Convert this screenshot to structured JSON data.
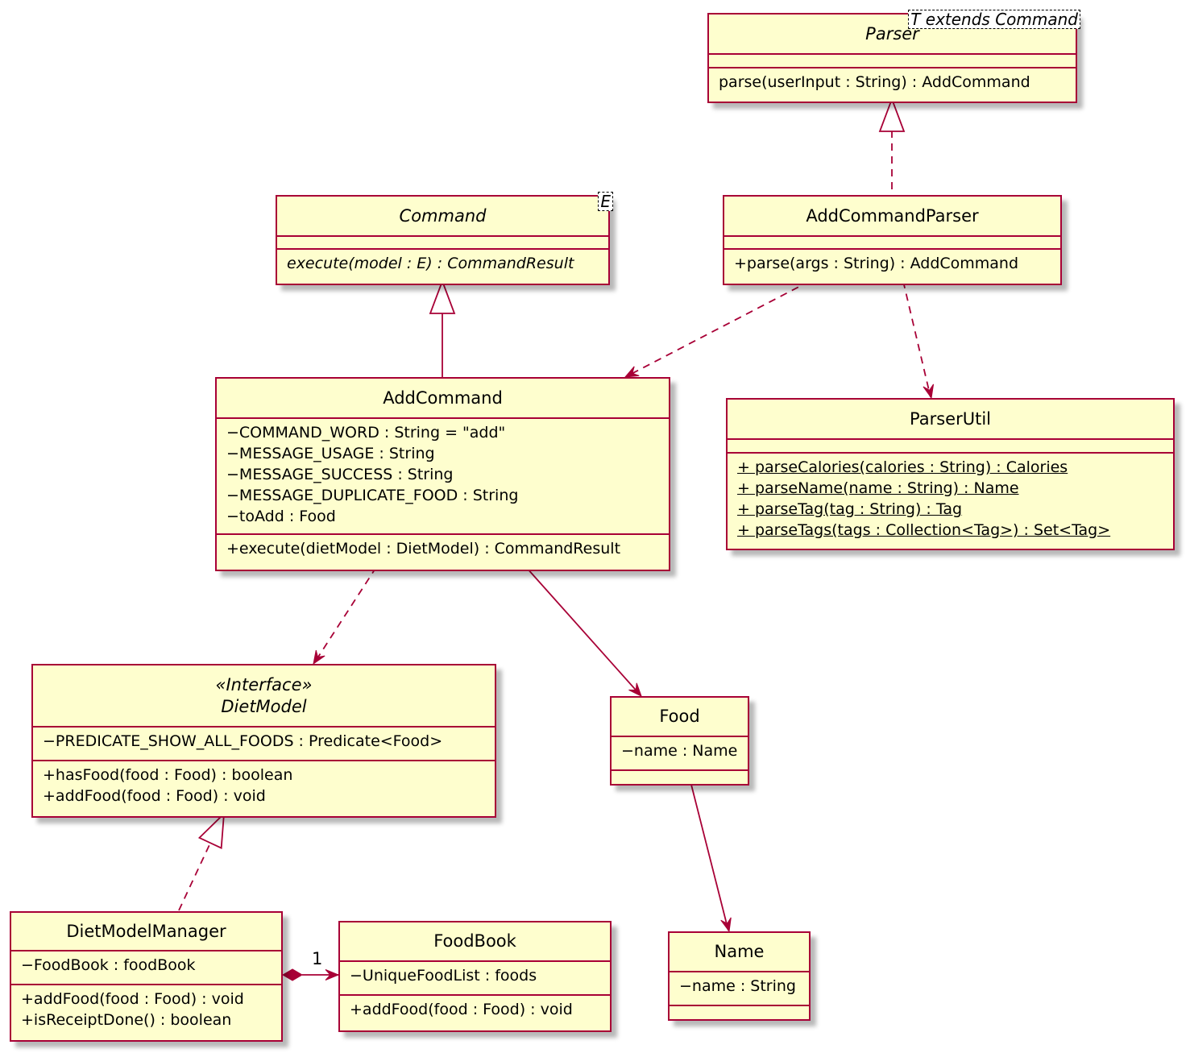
{
  "colors": {
    "border": "#A80036",
    "fill": "#FEFECE"
  },
  "classes": [
    {
      "id": "parser",
      "name": "Parser",
      "italic": true,
      "template": "T extends Command",
      "attributes": [],
      "methods": [
        {
          "text": "parse(userInput : String) : AddCommand"
        }
      ]
    },
    {
      "id": "command",
      "name": "Command",
      "italic": true,
      "template": "E",
      "attributes": [],
      "methods": [
        {
          "text": "execute(model : E) : CommandResult",
          "italic": true
        }
      ]
    },
    {
      "id": "add-command-parser",
      "name": "AddCommandParser",
      "attributes": [],
      "methods": [
        {
          "text": "+parse(args : String) : AddCommand"
        }
      ]
    },
    {
      "id": "add-command",
      "name": "AddCommand",
      "attributes": [
        {
          "text": "−COMMAND_WORD : String = \"add\""
        },
        {
          "text": "−MESSAGE_USAGE : String"
        },
        {
          "text": "−MESSAGE_SUCCESS : String"
        },
        {
          "text": "−MESSAGE_DUPLICATE_FOOD : String"
        },
        {
          "text": "−toAdd : Food"
        }
      ],
      "methods": [
        {
          "text": "+execute(dietModel : DietModel) : CommandResult"
        }
      ]
    },
    {
      "id": "parser-util",
      "name": "ParserUtil",
      "attributes": [],
      "methods": [
        {
          "text": " + parseCalories(calories : String) : Calories",
          "static": true
        },
        {
          "text": " + parseName(name : String) : Name",
          "static": true
        },
        {
          "text": " + parseTag(tag : String) : Tag",
          "static": true
        },
        {
          "text": " + parseTags(tags : Collection<Tag>) : Set<Tag>",
          "static": true
        }
      ]
    },
    {
      "id": "diet-model",
      "stereotype": "«Interface»",
      "name": "DietModel",
      "italic": true,
      "attributes": [
        {
          "text": "−PREDICATE_SHOW_ALL_FOODS : Predicate<Food>"
        }
      ],
      "methods": [
        {
          "text": "+hasFood(food : Food) : boolean"
        },
        {
          "text": "+addFood(food : Food) : void"
        }
      ]
    },
    {
      "id": "food",
      "name": "Food",
      "attributes": [
        {
          "text": "−name : Name"
        }
      ],
      "methods": []
    },
    {
      "id": "name",
      "name": "Name",
      "attributes": [
        {
          "text": "−name : String"
        }
      ],
      "methods": []
    },
    {
      "id": "diet-model-manager",
      "name": "DietModelManager",
      "attributes": [
        {
          "text": "−FoodBook : foodBook"
        }
      ],
      "methods": [
        {
          "text": "+addFood(food : Food) : void"
        },
        {
          "text": "+isReceiptDone() : boolean"
        }
      ]
    },
    {
      "id": "food-book",
      "name": "FoodBook",
      "attributes": [
        {
          "text": "−UniqueFoodList : foods"
        }
      ],
      "methods": [
        {
          "text": "+addFood(food : Food) : void"
        }
      ]
    }
  ],
  "relations": [
    {
      "from": "add-command-parser",
      "to": "parser",
      "type": "realization"
    },
    {
      "from": "add-command",
      "to": "command",
      "type": "generalization"
    },
    {
      "from": "add-command-parser",
      "to": "add-command",
      "type": "dependency"
    },
    {
      "from": "add-command-parser",
      "to": "parser-util",
      "type": "dependency"
    },
    {
      "from": "add-command",
      "to": "diet-model",
      "type": "dependency"
    },
    {
      "from": "add-command",
      "to": "food",
      "type": "association"
    },
    {
      "from": "food",
      "to": "name",
      "type": "association"
    },
    {
      "from": "diet-model-manager",
      "to": "diet-model",
      "type": "realization"
    },
    {
      "from": "diet-model-manager",
      "to": "food-book",
      "type": "composition",
      "multiplicity": "1"
    }
  ]
}
